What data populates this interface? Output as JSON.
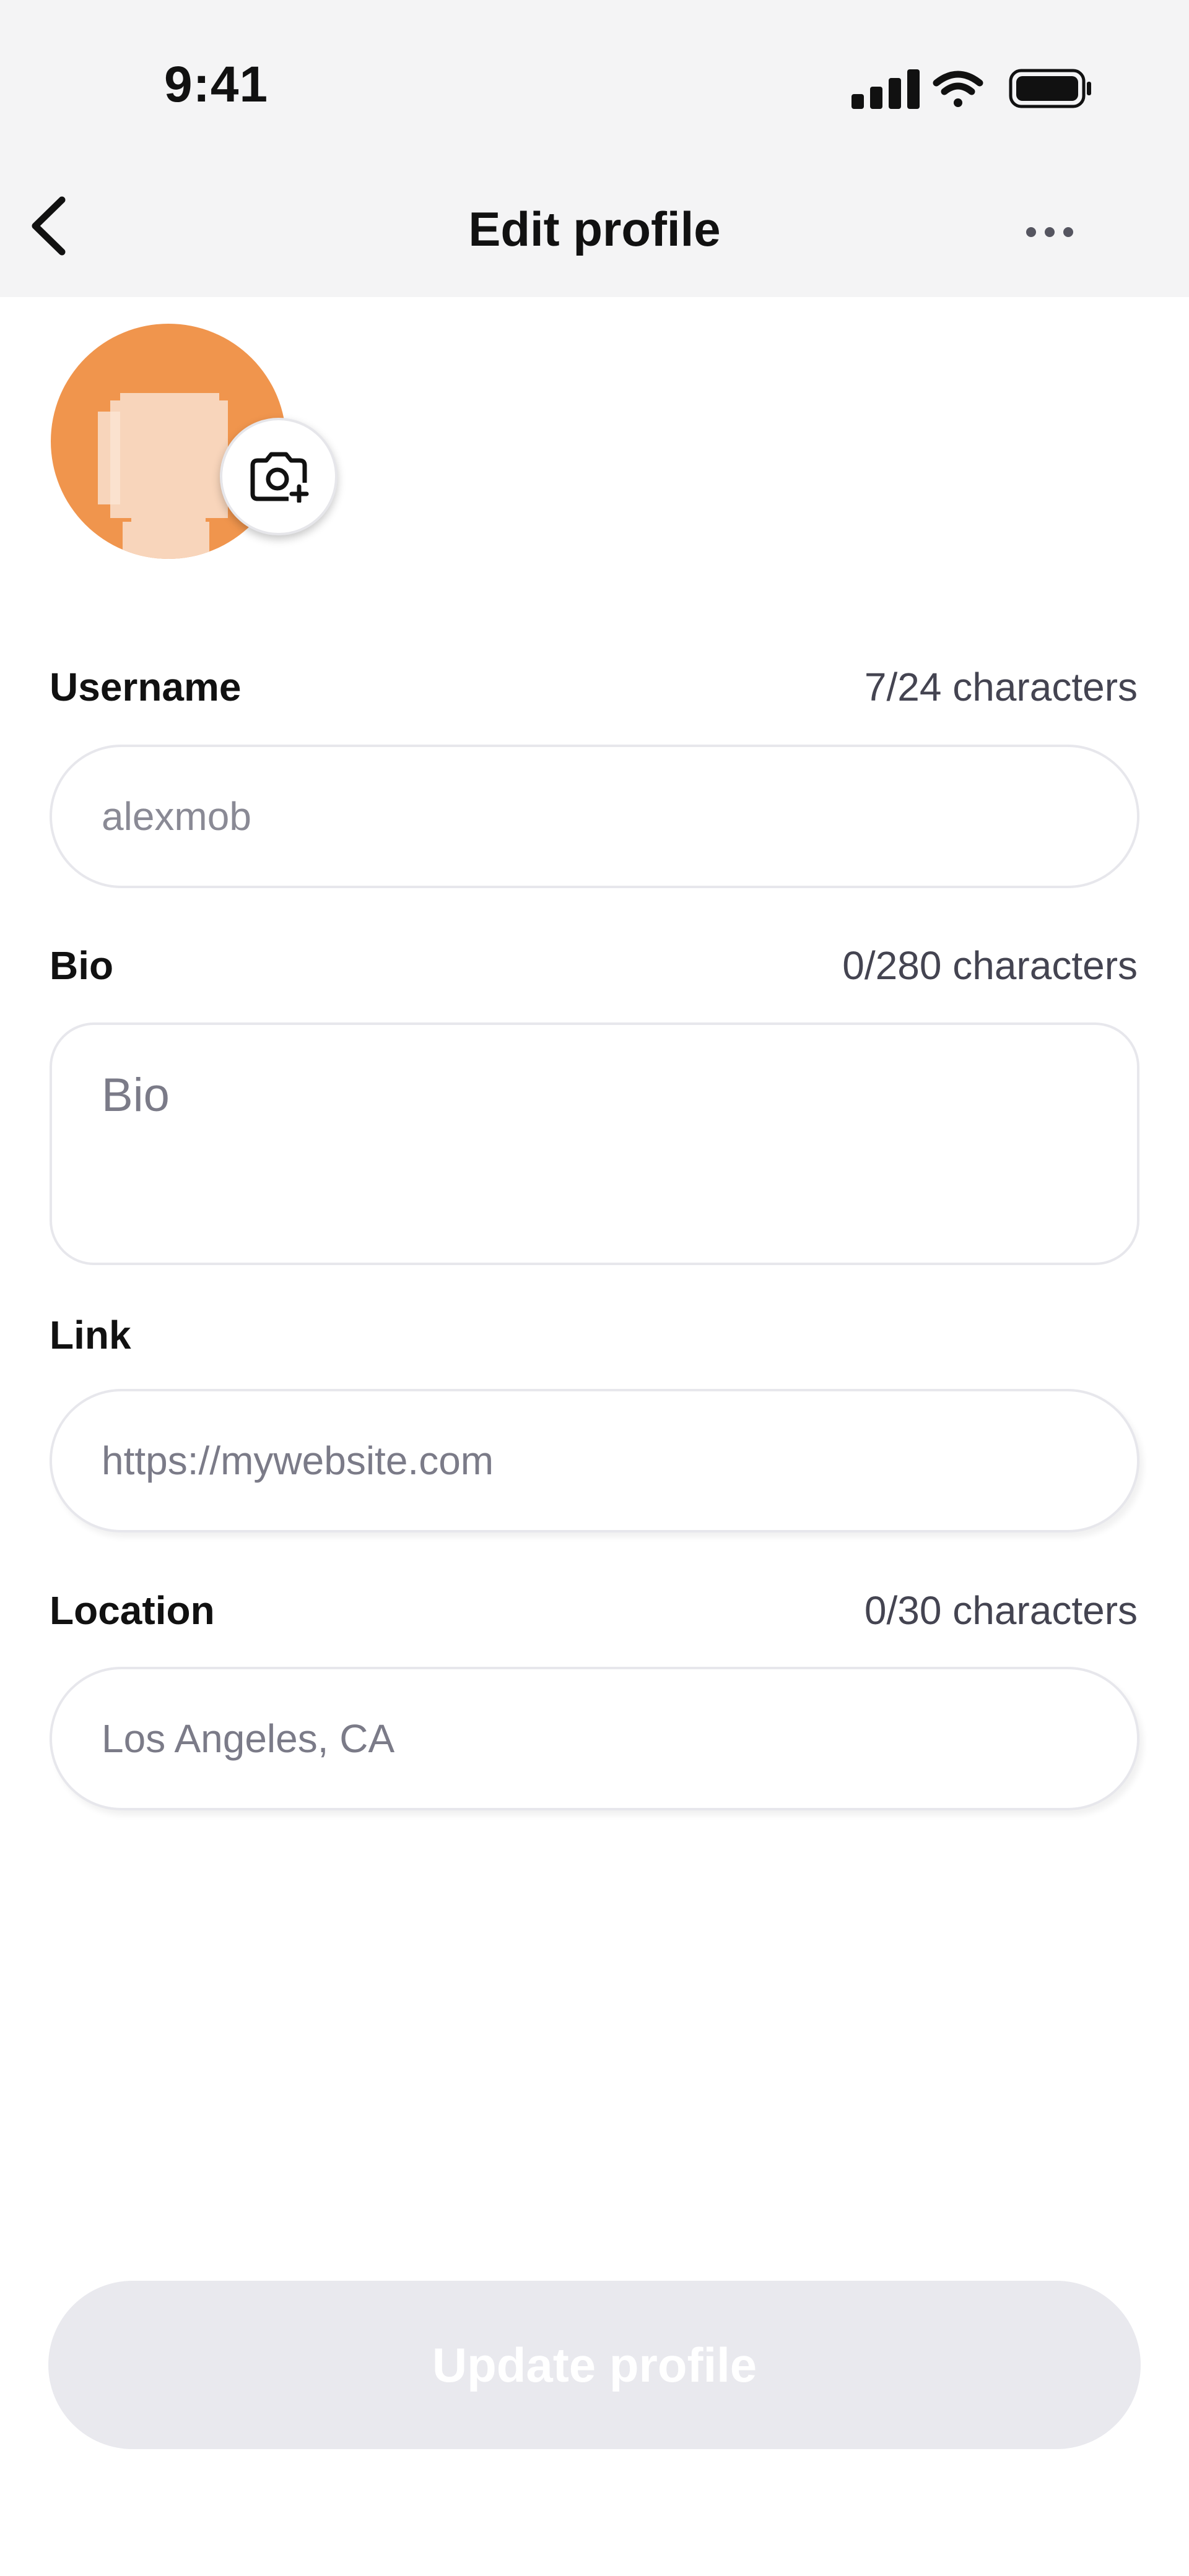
{
  "status_bar": {
    "time": "9:41",
    "icons": [
      "cellular-signal-icon",
      "wifi-icon",
      "battery-icon"
    ]
  },
  "nav": {
    "title": "Edit profile",
    "back_icon": "chevron-left-icon",
    "more_icon": "ellipsis-icon"
  },
  "avatar": {
    "background_color": "#f0954d",
    "camera_icon": "camera-add-icon"
  },
  "fields": {
    "username": {
      "label": "Username",
      "counter": "7/24 characters",
      "value": "alexmob"
    },
    "bio": {
      "label": "Bio",
      "counter": "0/280 characters",
      "placeholder": "Bio"
    },
    "link": {
      "label": "Link",
      "placeholder": "https://mywebsite.com"
    },
    "location": {
      "label": "Location",
      "counter": "0/30 characters",
      "placeholder": "Los Angeles, CA"
    }
  },
  "update_button": {
    "label": "Update profile",
    "disabled": true
  }
}
